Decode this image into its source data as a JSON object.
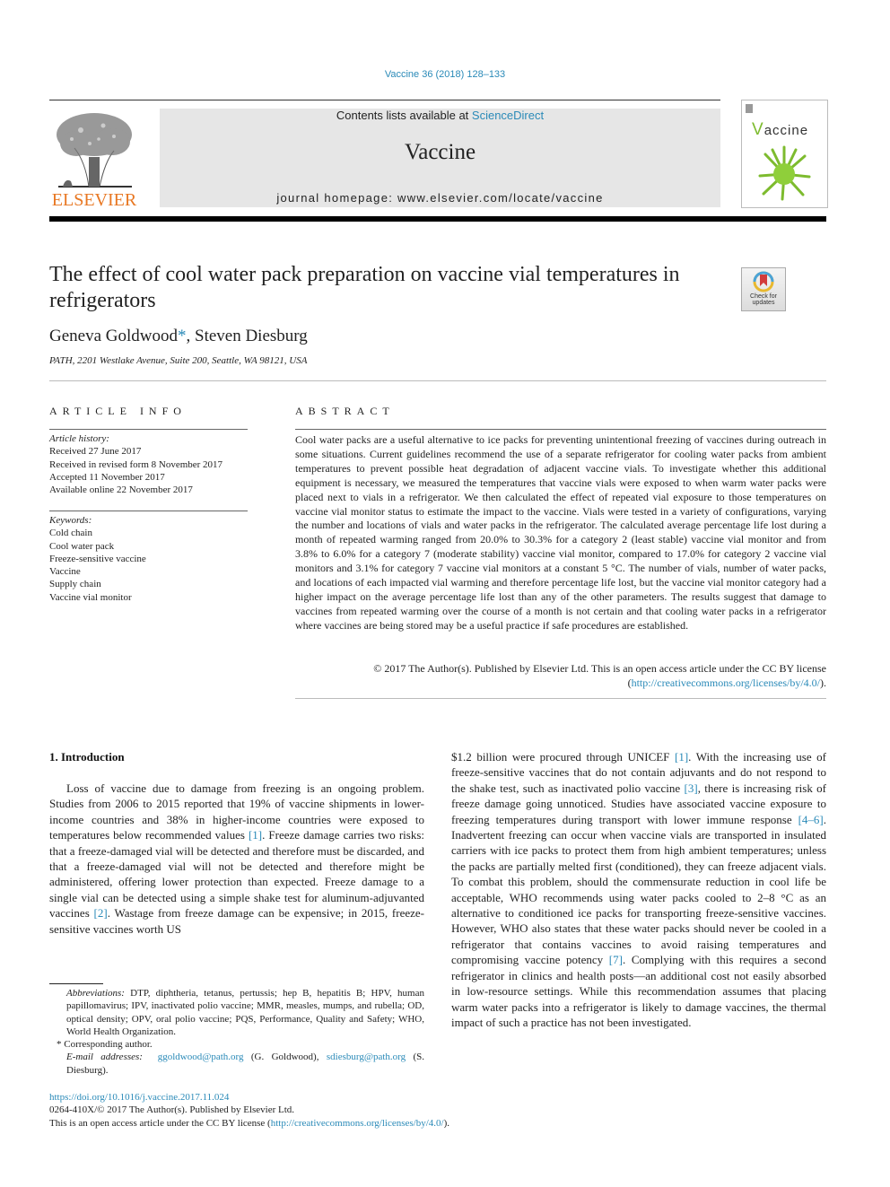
{
  "header": {
    "citation": "Vaccine 36 (2018) 128–133",
    "contents_prefix": "Contents lists available at ",
    "contents_link": "ScienceDirect",
    "journal_title": "Vaccine",
    "homepage": "journal homepage: www.elsevier.com/locate/vaccine",
    "publisher_logo_text": "ELSEVIER",
    "cover_title_initial": "V",
    "cover_title_rest": "accine",
    "crossmark_label_1": "Check for",
    "crossmark_label_2": "updates",
    "colors": {
      "link": "#2a8ab8",
      "elsevier_orange": "#e87722",
      "banner_gray": "#e6e6e6",
      "cover_green": "#7dbb2e"
    }
  },
  "article": {
    "title": "The effect of cool water pack preparation on vaccine vial temperatures in refrigerators",
    "authors": {
      "first": "Geneva Goldwood",
      "star": "*",
      "rest": ", Steven Diesburg"
    },
    "affiliation": "PATH, 2201 Westlake Avenue, Suite 200, Seattle, WA 98121, USA"
  },
  "article_info": {
    "heading": "ARTICLE INFO",
    "history_label": "Article history:",
    "history": [
      "Received 27 June 2017",
      "Received in revised form 8 November 2017",
      "Accepted 11 November 2017",
      "Available online 22 November 2017"
    ],
    "keywords_label": "Keywords:",
    "keywords": [
      "Cold chain",
      "Cool water pack",
      "Freeze-sensitive vaccine",
      "Vaccine",
      "Supply chain",
      "Vaccine vial monitor"
    ]
  },
  "abstract": {
    "heading": "ABSTRACT",
    "text": "Cool water packs are a useful alternative to ice packs for preventing unintentional freezing of vaccines during outreach in some situations. Current guidelines recommend the use of a separate refrigerator for cooling water packs from ambient temperatures to prevent possible heat degradation of adjacent vaccine vials. To investigate whether this additional equipment is necessary, we measured the temperatures that vaccine vials were exposed to when warm water packs were placed next to vials in a refrigerator. We then calculated the effect of repeated vial exposure to those temperatures on vaccine vial monitor status to estimate the impact to the vaccine. Vials were tested in a variety of configurations, varying the number and locations of vials and water packs in the refrigerator. The calculated average percentage life lost during a month of repeated warming ranged from 20.0% to 30.3% for a category 2 (least stable) vaccine vial monitor and from 3.8% to 6.0% for a category 7 (moderate stability) vaccine vial monitor, compared to 17.0% for category 2 vaccine vial monitors and 3.1% for category 7 vaccine vial monitors at a constant 5 °C. The number of vials, number of water packs, and locations of each impacted vial warming and therefore percentage life lost, but the vaccine vial monitor category had a higher impact on the average percentage life lost than any of the other parameters. The results suggest that damage to vaccines from repeated warming over the course of a month is not certain and that cooling water packs in a refrigerator where vaccines are being stored may be a useful practice if safe procedures are established.",
    "copyright": "© 2017 The Author(s). Published by Elsevier Ltd. This is an open access article under the CC BY license",
    "license_open": "(",
    "license_link": "http://creativecommons.org/licenses/by/4.0/",
    "license_close": ")."
  },
  "introduction": {
    "heading": "1. Introduction",
    "left_parts": [
      "Loss of vaccine due to damage from freezing is an ongoing problem. Studies from 2006 to 2015 reported that 19% of vaccine shipments in lower-income countries and 38% in higher-income countries were exposed to temperatures below recommended values ",
      "[1]",
      ". Freeze damage carries two risks: that a freeze-damaged vial will be detected and therefore must be discarded, and that a freeze-damaged vial will not be detected and therefore might be administered, offering lower protection than expected. Freeze damage to a single vial can be detected using a simple shake test for aluminum-adjuvanted vaccines ",
      "[2]",
      ". Wastage from freeze damage can be expensive; in 2015, freeze-sensitive vaccines worth US"
    ],
    "right_parts": [
      "$1.2 billion were procured through UNICEF ",
      "[1]",
      ". With the increasing use of freeze-sensitive vaccines that do not contain adjuvants and do not respond to the shake test, such as inactivated polio vaccine ",
      "[3]",
      ", there is increasing risk of freeze damage going unnoticed. Studies have associated vaccine exposure to freezing temperatures during transport with lower immune response ",
      "[4–6]",
      ". Inadvertent freezing can occur when vaccine vials are transported in insulated carriers with ice packs to protect them from high ambient temperatures; unless the packs are partially melted first (conditioned), they can freeze adjacent vials. To combat this problem, should the commensurate reduction in cool life be acceptable, WHO recommends using water packs cooled to 2–8 °C as an alternative to conditioned ice packs for transporting freeze-sensitive vaccines. However, WHO also states that these water packs should never be cooled in a refrigerator that contains vaccines to avoid raising temperatures and compromising vaccine potency ",
      "[7]",
      ". Complying with this requires a second refrigerator in clinics and health posts—an additional cost not easily absorbed in low-resource settings. While this recommendation assumes that placing warm water packs into a refrigerator is likely to damage vaccines, the thermal impact of such a practice has not been investigated."
    ]
  },
  "footnotes": {
    "abbrev_label": "Abbreviations:",
    "abbrev_text": " DTP, diphtheria, tetanus, pertussis; hep B, hepatitis B; HPV, human papillomavirus; IPV, inactivated polio vaccine; MMR, measles, mumps, and rubella; OD, optical density; OPV, oral polio vaccine; PQS, Performance, Quality and Safety; WHO, World Health Organization.",
    "corresponding": "* Corresponding author.",
    "email_label": "E-mail addresses:",
    "email_1": "ggoldwood@path.org",
    "email_1_name": " (G. Goldwood), ",
    "email_2": "sdiesburg@path.org",
    "email_2_name": " (S. Diesburg)."
  },
  "footer": {
    "doi": "https://doi.org/10.1016/j.vaccine.2017.11.024",
    "issn_line": "0264-410X/© 2017 The Author(s). Published by Elsevier Ltd.",
    "oa_prefix": "This is an open access article under the CC BY license (",
    "oa_link": "http://creativecommons.org/licenses/by/4.0/",
    "oa_suffix": ")."
  }
}
